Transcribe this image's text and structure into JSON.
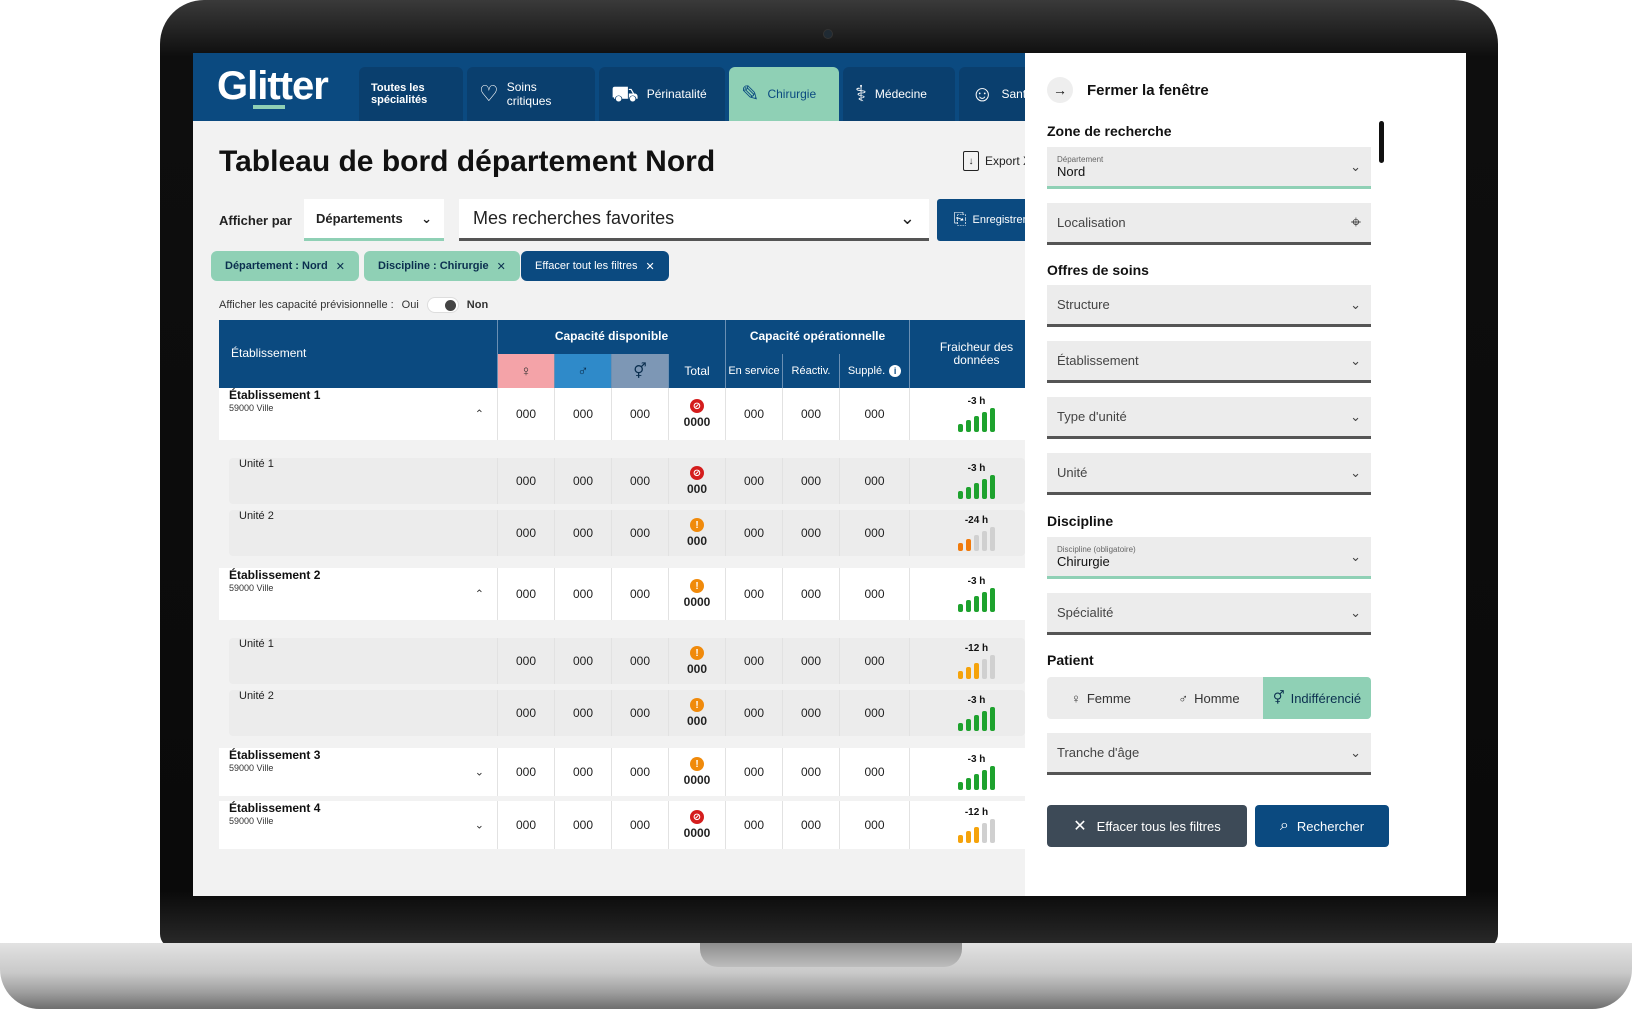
{
  "app": {
    "logo": "Glitter"
  },
  "nav": {
    "tabs": [
      {
        "label": "Toutes les spécialités",
        "icon": ""
      },
      {
        "label": "Soins critiques",
        "icon": "heart-pulse-icon"
      },
      {
        "label": "Périnatalité",
        "icon": "stroller-icon"
      },
      {
        "label": "Chirurgie",
        "icon": "scalpel-icon"
      },
      {
        "label": "Médecine",
        "icon": "stethoscope-icon"
      },
      {
        "label": "Sant",
        "icon": "head-icon"
      }
    ],
    "active_tab": "Chirurgie"
  },
  "main": {
    "title": "Tableau de bord département Nord",
    "export_label": "Export XLS",
    "afficher_par_label": "Afficher par",
    "afficher_par_value": "Départements",
    "favorites_value": "Mes recherches favorites",
    "save_label": "Enregistrer",
    "chips": [
      "Département : Nord",
      "Discipline : Chirurgie",
      "Effacer tout les filtres"
    ],
    "prev_label": "Afficher les capacité prévisionnelle :",
    "prev_oui": "Oui",
    "prev_non": "Non"
  },
  "table": {
    "headers": {
      "etablissement": "Établissement",
      "capacite_disponible": "Capacité disponible",
      "capacite_operationnelle": "Capacité opérationnelle",
      "fraicheur": "Fraicheur des données",
      "female": "♀",
      "male": "♂",
      "both": "⚥",
      "total": "Total",
      "en_service": "En service",
      "reactiv": "Réactiv.",
      "supple": "Supplé."
    },
    "rows": [
      {
        "name": "Établissement 1",
        "sub": "59000 Ville",
        "chevron": "⌃",
        "vals": [
          "000",
          "000",
          "000"
        ],
        "total": "0000",
        "status": "red",
        "ops": [
          "000",
          "000",
          "000"
        ],
        "fresh": "-3 h",
        "level": 5,
        "level_color": "green"
      },
      {
        "name": "Unité 1",
        "vals": [
          "000",
          "000",
          "000"
        ],
        "total": "000",
        "status": "red",
        "ops": [
          "000",
          "000",
          "000"
        ],
        "fresh": "-3 h",
        "level": 5,
        "level_color": "green"
      },
      {
        "name": "Unité 2",
        "vals": [
          "000",
          "000",
          "000"
        ],
        "total": "000",
        "status": "orange",
        "ops": [
          "000",
          "000",
          "000"
        ],
        "fresh": "-24 h",
        "level": 2,
        "level_color": "orange"
      },
      {
        "name": "Établissement 2",
        "sub": "59000 Ville",
        "chevron": "⌃",
        "vals": [
          "000",
          "000",
          "000"
        ],
        "total": "0000",
        "status": "orange",
        "ops": [
          "000",
          "000",
          "000"
        ],
        "fresh": "-3 h",
        "level": 5,
        "level_color": "green"
      },
      {
        "name": "Unité 1",
        "vals": [
          "000",
          "000",
          "000"
        ],
        "total": "000",
        "status": "orange",
        "ops": [
          "000",
          "000",
          "000"
        ],
        "fresh": "-12 h",
        "level": 3,
        "level_color": "yellow"
      },
      {
        "name": "Unité 2",
        "vals": [
          "000",
          "000",
          "000"
        ],
        "total": "000",
        "status": "orange",
        "ops": [
          "000",
          "000",
          "000"
        ],
        "fresh": "-3 h",
        "level": 5,
        "level_color": "green"
      },
      {
        "name": "Établissement 3",
        "sub": "59000 Ville",
        "chevron": "⌄",
        "vals": [
          "000",
          "000",
          "000"
        ],
        "total": "0000",
        "status": "orange",
        "ops": [
          "000",
          "000",
          "000"
        ],
        "fresh": "-3 h",
        "level": 5,
        "level_color": "green"
      },
      {
        "name": "Établissement 4",
        "sub": "59000 Ville",
        "chevron": "⌄",
        "vals": [
          "000",
          "000",
          "000"
        ],
        "total": "0000",
        "status": "red",
        "ops": [
          "000",
          "000",
          "000"
        ],
        "fresh": "-12 h",
        "level": 3,
        "level_color": "yellow"
      }
    ]
  },
  "panel": {
    "close_label": "Fermer la fenêtre",
    "zone_heading": "Zone de recherche",
    "departement_mini": "Département",
    "departement_value": "Nord",
    "localisation_placeholder": "Localisation",
    "offres_heading": "Offres de soins",
    "structure": "Structure",
    "etablissement": "Établissement",
    "type_unite": "Type d'unité",
    "unite": "Unité",
    "discipline_heading": "Discipline",
    "discipline_mini": "Discipline (obligatoire)",
    "discipline_value": "Chirurgie",
    "specialite": "Spécialité",
    "patient_heading": "Patient",
    "patient_options": [
      "Femme",
      "Homme",
      "Indifférencié"
    ],
    "patient_selected": "Indifférencié",
    "tranche_age": "Tranche d'âge",
    "clear_label": "Effacer tous les filtres",
    "search_label": "Rechercher"
  },
  "colors": {
    "brand_blue": "#0b4a80",
    "accent_green": "#8fd0b5",
    "female_pink": "#f4a3a8",
    "male_blue": "#2f8ac9",
    "both_grey": "#7d97b5",
    "status_red": "#d41d1d",
    "status_orange": "#f08a0b",
    "level_green": "#1ea22e",
    "level_yellow": "#f5a30b",
    "level_orange": "#f07a0b"
  }
}
